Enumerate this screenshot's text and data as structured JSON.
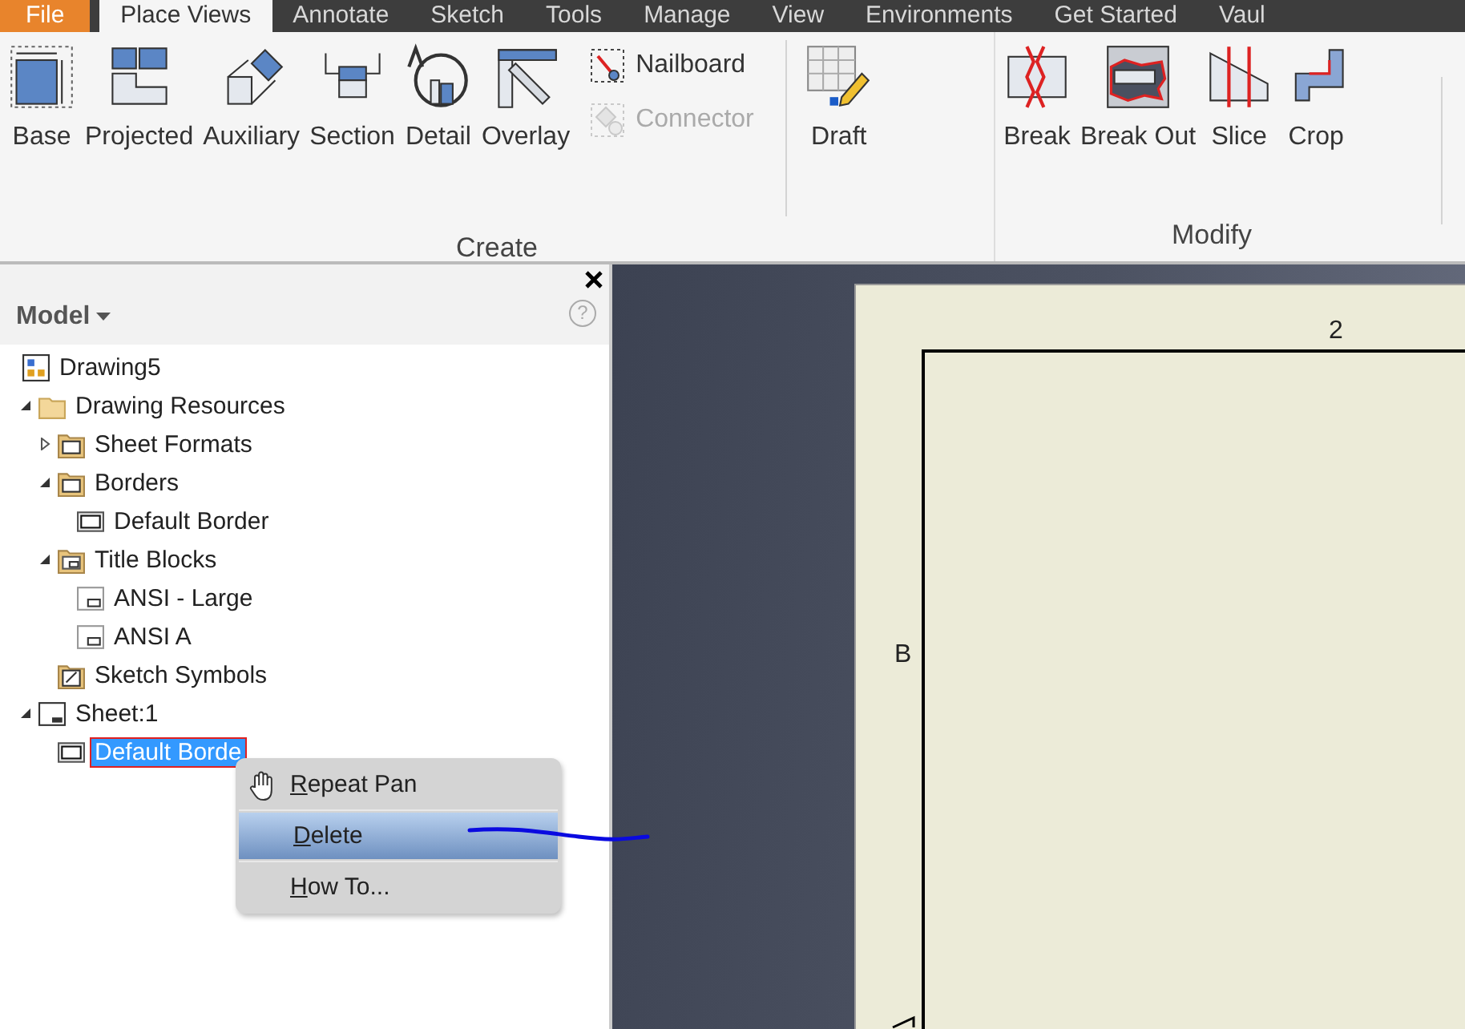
{
  "tabs": [
    {
      "label": "File",
      "kind": "application",
      "selected": false
    },
    {
      "label": "Place Views",
      "kind": "ribbon",
      "selected": true
    },
    {
      "label": "Annotate",
      "kind": "ribbon",
      "selected": false
    },
    {
      "label": "Sketch",
      "kind": "ribbon",
      "selected": false
    },
    {
      "label": "Tools",
      "kind": "ribbon",
      "selected": false
    },
    {
      "label": "Manage",
      "kind": "ribbon",
      "selected": false
    },
    {
      "label": "View",
      "kind": "ribbon",
      "selected": false
    },
    {
      "label": "Environments",
      "kind": "ribbon",
      "selected": false
    },
    {
      "label": "Get Started",
      "kind": "ribbon",
      "selected": false
    },
    {
      "label": "Vaul",
      "kind": "ribbon",
      "selected": false
    }
  ],
  "ribbon": {
    "groups": [
      {
        "label": "Create",
        "items": [
          {
            "kind": "base",
            "label": "Base"
          },
          {
            "kind": "projected",
            "label": "Projected"
          },
          {
            "kind": "auxiliary",
            "label": "Auxiliary"
          },
          {
            "kind": "section",
            "label": "Section"
          },
          {
            "kind": "detail",
            "label": "Detail"
          },
          {
            "kind": "overlay",
            "label": "Overlay"
          },
          {
            "kind": "stack",
            "buttons": [
              {
                "kind": "nailboard",
                "label": "Nailboard",
                "disabled": false
              },
              {
                "kind": "connector",
                "label": "Connector",
                "disabled": true
              }
            ]
          },
          {
            "kind": "draft",
            "label": "Draft",
            "divider_before": true
          }
        ]
      },
      {
        "label": "Modify",
        "items": [
          {
            "kind": "break",
            "label": "Break"
          },
          {
            "kind": "break-out",
            "label": "Break Out"
          },
          {
            "kind": "slice",
            "label": "Slice"
          },
          {
            "kind": "crop",
            "label": "Crop"
          }
        ]
      }
    ]
  },
  "browser": {
    "title": "Model",
    "help": "?",
    "tree": [
      {
        "label": "Drawing5",
        "kind": "document",
        "selected": false,
        "children": [
          {
            "label": "Drawing Resources",
            "kind": "folder",
            "expanded": true,
            "selected": false,
            "children": [
              {
                "label": "Sheet Formats",
                "kind": "border-folder",
                "expanded": false,
                "selected": false
              },
              {
                "label": "Borders",
                "kind": "border-folder",
                "expanded": true,
                "selected": false,
                "children": [
                  {
                    "label": "Default Border",
                    "kind": "border",
                    "selected": false
                  }
                ]
              },
              {
                "label": "Title Blocks",
                "kind": "titleblock-folder",
                "expanded": true,
                "selected": false,
                "children": [
                  {
                    "label": "ANSI - Large",
                    "kind": "titleblock",
                    "selected": false
                  },
                  {
                    "label": "ANSI A",
                    "kind": "titleblock",
                    "selected": false
                  }
                ]
              },
              {
                "label": "Sketch Symbols",
                "kind": "symbol-folder",
                "selected": false
              }
            ]
          },
          {
            "label": "Sheet:1",
            "kind": "sheet",
            "expanded": true,
            "selected": false,
            "children": [
              {
                "label": "Default Borde",
                "kind": "border",
                "selected": true
              }
            ]
          }
        ]
      }
    ]
  },
  "context_menu": [
    {
      "label": "Repeat Pan",
      "kind": "pan",
      "selected": false
    },
    {
      "label": "Delete",
      "kind": "command",
      "selected": true
    },
    {
      "label": "How To...",
      "kind": "command",
      "selected": false
    }
  ],
  "sheet": {
    "column_label": "2",
    "row_label": "B"
  }
}
